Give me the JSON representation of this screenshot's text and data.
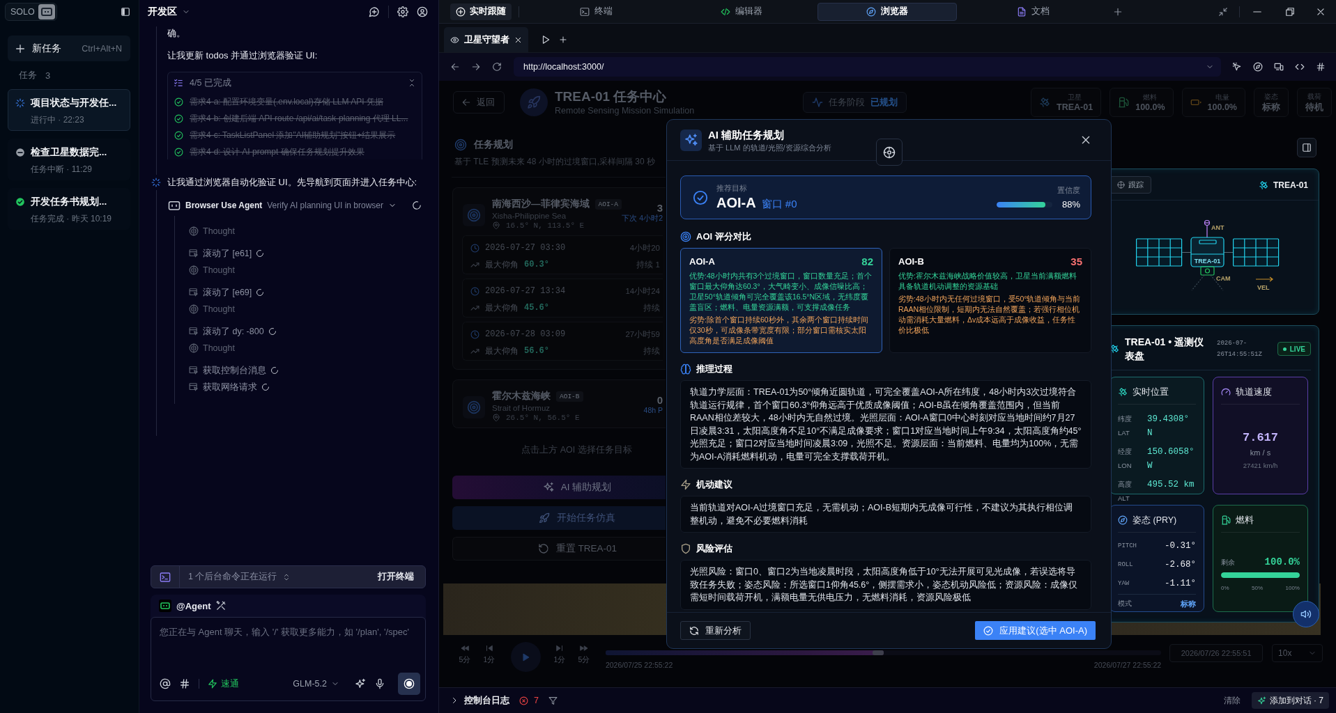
{
  "sidebar": {
    "logo": "SOLO",
    "new_task": {
      "label": "新任务",
      "shortcut": "Ctrl+Alt+N"
    },
    "tasks_label": "任务",
    "tasks_count": "3",
    "tasks": [
      {
        "title": "项目状态与开发任...",
        "meta": "进行中 · 22:23",
        "kind": "running",
        "selected": true
      },
      {
        "title": "检查卫星数据完...",
        "meta": "任务中断 · 11:29",
        "kind": "interrupted",
        "selected": false
      },
      {
        "title": "开发任务书规划...",
        "meta": "任务完成 · 昨天 10:19",
        "kind": "done",
        "selected": false
      }
    ]
  },
  "chat": {
    "title": "开发区",
    "messages": [
      "确。",
      "让我更新 todos 并通过浏览器验证 UI:"
    ],
    "todos": {
      "summary": "4/5 已完成",
      "items": [
        {
          "text": "需求4-a: 配置环境变量(.env.local)存储 LLM API 凭据",
          "done": true
        },
        {
          "text": "需求4-b: 创建后端 API route /api/ai/task-planning 代理 LL...",
          "done": true
        },
        {
          "text": "需求4-c: TaskListPanel 添加\"AI辅助规划\"按钮+结果展示",
          "done": true
        },
        {
          "text": "需求4-d: 设计 AI prompt 确保任务规划提升效果",
          "done": true
        }
      ]
    },
    "status": {
      "text": "让我通过浏览器自动化验证 UI。先导航到页面并进入任务中心:",
      "running": true
    },
    "agent": {
      "name": "Browser Use Agent",
      "task": "Verify AI planning UI in browser",
      "running": true,
      "steps": [
        {
          "kind": "thought",
          "text": "Thought",
          "running": false
        },
        {
          "kind": "action",
          "text": "滚动了 [e61]",
          "running": true
        },
        {
          "kind": "thought",
          "text": "Thought",
          "running": false
        },
        {
          "kind": "action",
          "text": "滚动了 [e69]",
          "running": true
        },
        {
          "kind": "thought",
          "text": "Thought",
          "running": false
        },
        {
          "kind": "action",
          "text": "滚动了 dy: -800",
          "running": true
        },
        {
          "kind": "thought",
          "text": "Thought",
          "running": false
        },
        {
          "kind": "action",
          "text": "获取控制台消息",
          "running": true
        },
        {
          "kind": "action",
          "text": "获取网络请求",
          "running": true
        }
      ]
    },
    "background": {
      "text": "1 个后台命令正在运行",
      "action": "打开终端"
    },
    "composer": {
      "mention": "@Agent",
      "placeholder": "您正在与 Agent 聊天，输入 '/' 获取更多能力，如 '/plan', '/spec'",
      "mode": "速通",
      "model": "GLM-5.2"
    }
  },
  "workspace": {
    "follow": "实时跟随",
    "tabs": [
      {
        "kind": "terminal",
        "label": "终端",
        "selected": false
      },
      {
        "kind": "editor",
        "label": "编辑器",
        "selected": false
      },
      {
        "kind": "browser",
        "label": "浏览器",
        "selected": true
      },
      {
        "kind": "docs",
        "label": "文档",
        "selected": false
      }
    ]
  },
  "browser": {
    "tabs": [
      {
        "label": "卫星守望者",
        "selected": true
      }
    ],
    "url": "http://localhost:3000/"
  },
  "page": {
    "header": {
      "back": "返回",
      "title": "TREA-01 任务中心",
      "subtitle": "Remote Sensing Mission Simulation",
      "phase_label": "任务阶段",
      "phase_value": "已规划",
      "stats": [
        {
          "kind": "satellite",
          "label": "卫星",
          "value": "TREA-01"
        },
        {
          "kind": "fuel",
          "label": "燃料",
          "value": "100.0%"
        },
        {
          "kind": "power",
          "label": "电量",
          "value": "100.0%"
        },
        {
          "kind": "attitude",
          "label": "姿态",
          "value": "标称"
        },
        {
          "kind": "payload",
          "label": "载荷",
          "value": "待机"
        }
      ]
    },
    "planning": {
      "title": "任务规划",
      "subtitle": "基于 TLE 预测未来 48 小时的过境窗口,采样间隔 30 秒",
      "aois": [
        {
          "name": "南海西沙—菲律宾海域",
          "tag": "AOI-A",
          "name_en": "Xisha-Philippine Sea",
          "coords": "16.5° N, 113.5° E",
          "count": "3",
          "next": "下次 4小时2",
          "windows": [
            {
              "time": "2026-07-27 03:30",
              "eta": "4小时20",
              "elevation_label": "最大仰角",
              "elevation": "60.3°",
              "duration": "持续 1"
            },
            {
              "time": "2026-07-27 13:34",
              "eta": "14小时24",
              "elevation_label": "最大仰角",
              "elevation": "45.6°",
              "duration": "持续"
            },
            {
              "time": "2026-07-28 03:09",
              "eta": "27小时59",
              "elevation_label": "最大仰角",
              "elevation": "56.6°",
              "duration": "持续"
            }
          ]
        },
        {
          "name": "霍尔木兹海峡",
          "tag": "AOI-B",
          "name_en": "Strait of Hormuz",
          "coords": "26.5° N, 56.5° E",
          "count": "0",
          "next": "48h P"
        }
      ],
      "hint": "点击上方 AOI 选择任务目标",
      "actions": [
        {
          "kind": "ai",
          "label": "AI 辅助规划"
        },
        {
          "kind": "start",
          "label": "开始任务仿真"
        },
        {
          "kind": "reset",
          "label": "重置 TREA-01"
        }
      ]
    },
    "timeline": {
      "steps": [
        {
          "kind": "back",
          "label": "5分"
        },
        {
          "kind": "step_back",
          "label": "1分"
        },
        {
          "kind": "step_forward",
          "label": "1分"
        },
        {
          "kind": "forward",
          "label": "5分"
        }
      ],
      "level": 0.5,
      "start": "2026/07/25 22:55:22",
      "end": "2026/07/27 22:55:22",
      "current": "2026/07/26 22:55:51",
      "speed": "10x"
    }
  },
  "satellite_view": {
    "track": "跟踪",
    "name": "TREA-01",
    "labels": {
      "antenna": "ANT",
      "body": "TREA-01",
      "camera": "CAM",
      "velocity": "VEL"
    }
  },
  "telemetry": {
    "title": "TREA-01 • 遥测仪表盘",
    "timestamp": "2026-07-26T14:55:51Z",
    "live": "LIVE",
    "position": {
      "title": "实时位置",
      "rows": [
        {
          "label": "纬度 LAT",
          "value": "39.4308° N"
        },
        {
          "label": "经度 LON",
          "value": "150.6058° W"
        },
        {
          "label": "高度 ALT",
          "value": "495.52 km"
        }
      ]
    },
    "velocity": {
      "title": "轨道速度",
      "value": "7.617",
      "unit": "km / s",
      "secondary": "27421 km/h"
    },
    "attitude": {
      "title": "姿态 (PRY)",
      "rows": [
        {
          "label": "PITCH",
          "value": "-0.31°"
        },
        {
          "label": "ROLL",
          "value": "-2.68°"
        },
        {
          "label": "YAW",
          "value": "-1.11°"
        }
      ],
      "mode_label": "模式",
      "mode": "标称"
    },
    "fuel": {
      "title": "燃料",
      "label": "剩余",
      "value": "100.0%",
      "level": 1,
      "ticks": [
        "0%",
        "50%",
        "100%"
      ]
    }
  },
  "modal": {
    "title": "AI 辅助任务规划",
    "subtitle": "基于 LLM 的轨道/光照/资源综合分析",
    "recommendation": {
      "label": "推荐目标",
      "target": "AOI-A",
      "window": "窗口 #0",
      "confidence_label": "置信度",
      "level": 0.88,
      "confidence": "88%"
    },
    "comparison_title": "AOI 评分对比",
    "scores": [
      {
        "name": "AOI-A",
        "score": "82",
        "color": "#34d399",
        "selected": true,
        "pros": "优势:48小时内共有3个过境窗口，窗口数量充足；首个窗口最大仰角达60.3°，大气畸变小、成像信噪比高；卫星50°轨道倾角可完全覆盖该16.5°N区域，无纬度覆盖盲区；燃料、电量资源满额，可支撑成像任务",
        "cons": "劣势:除首个窗口持续60秒外，其余两个窗口持续时间仅30秒，可成像条带宽度有限；部分窗口需核实太阳高度角是否满足成像阈值"
      },
      {
        "name": "AOI-B",
        "score": "35",
        "color": "#f87171",
        "selected": false,
        "pros": "优势:霍尔木兹海峡战略价值较高，卫星当前满额燃料具备轨道机动调整的资源基础",
        "cons": "劣势:48小时内无任何过境窗口，受50°轨道倾角与当前RAAN相位限制，短期内无法自然覆盖；若强行相位机动需消耗大量燃料，Δv成本远高于成像收益，任务性价比极低"
      }
    ],
    "sections": [
      {
        "kind": "reasoning",
        "title": "推理过程",
        "text": "轨道力学层面：TREA-01为50°倾角近圆轨道，可完全覆盖AOI-A所在纬度，48小时内3次过境符合轨道运行规律，首个窗口60.3°仰角远高于优质成像阈值；AOI-B虽在倾角覆盖范围内，但当前RAAN相位差较大，48小时内无自然过境。光照层面：AOI-A窗口0中心时刻对应当地时间约7月27日凌晨3:31，太阳高度角不足10°不满足成像要求；窗口1对应当地时间上午9:34，太阳高度角约45°光照充足；窗口2对应当地时间凌晨3:09，光照不足。资源层面：当前燃料、电量均为100%，无需为AOI-A消耗燃料机动，电量可完全支撑载荷开机。"
      },
      {
        "kind": "maneuver",
        "title": "机动建议",
        "text": "当前轨道对AOI-A过境窗口充足，无需机动；AOI-B短期内无成像可行性，不建议为其执行相位调整机动，避免不必要燃料消耗"
      },
      {
        "kind": "risk",
        "title": "风险评估",
        "text": "光照风险：窗口0、窗口2为当地凌晨时段，太阳高度角低于10°无法开展可见光成像，若误选将导致任务失败；姿态风险：所选窗口1仰角45.6°，侧摆需求小，姿态机动风险低；资源风险：成像仅需短时间载荷开机，满额电量无供电压力，无燃料消耗，资源风险极低"
      }
    ],
    "buttons": [
      {
        "kind": "secondary",
        "label": "重新分析"
      },
      {
        "kind": "primary",
        "label": "应用建议(选中 AOI-A)"
      }
    ]
  },
  "console": {
    "title": "控制台日志",
    "errors": "7",
    "clear": "清除",
    "add": "添加到对话 · 7"
  }
}
